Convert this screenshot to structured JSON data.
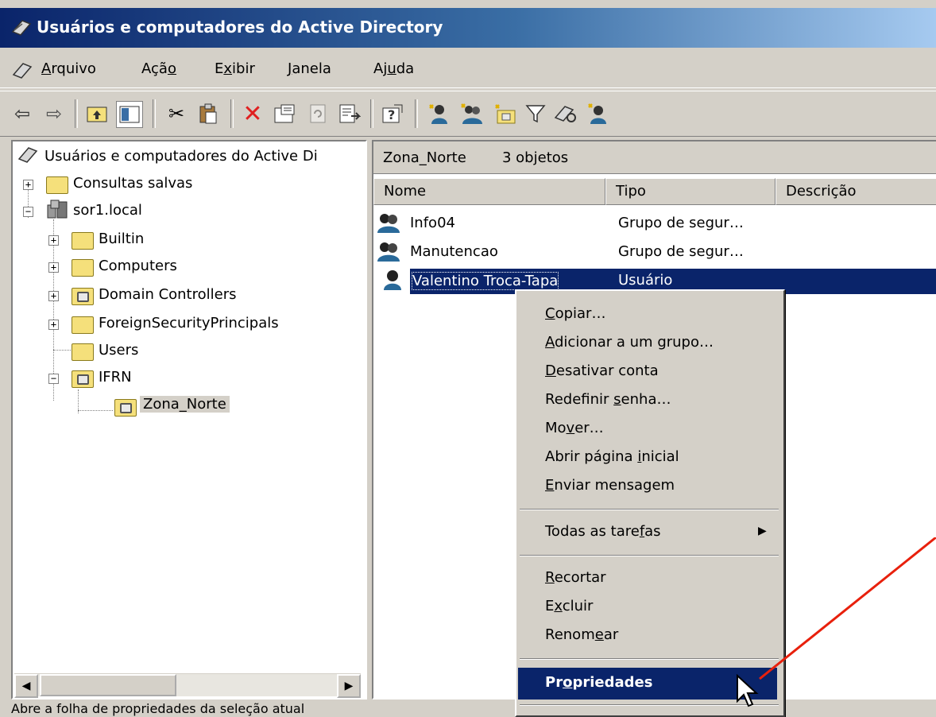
{
  "window": {
    "title": "Usuários e computadores do Active Directory"
  },
  "menu": [
    {
      "label": "Arquivo",
      "u": "A",
      "rest": "rquivo"
    },
    {
      "label": "Ação",
      "pre": "Açã",
      "u": "o",
      "rest": ""
    },
    {
      "label": "Exibir",
      "pre": "E",
      "u": "x",
      "rest": "ibir"
    },
    {
      "label": "Janela",
      "pre": "",
      "u": "J",
      "rest": "anela"
    },
    {
      "label": "Ajuda",
      "pre": "Aj",
      "u": "u",
      "rest": "da"
    }
  ],
  "tree": {
    "root": "Usuários e computadores do Active Di",
    "items": [
      {
        "label": "Consultas salvas",
        "icon": "folder-icon"
      },
      {
        "label": "sor1.local",
        "icon": "domain-icon"
      },
      {
        "label": "Builtin",
        "icon": "folder-icon"
      },
      {
        "label": "Computers",
        "icon": "folder-icon"
      },
      {
        "label": "Domain Controllers",
        "icon": "ou-icon"
      },
      {
        "label": "ForeignSecurityPrincipals",
        "icon": "folder-icon"
      },
      {
        "label": "Users",
        "icon": "folder-icon"
      },
      {
        "label": "IFRN",
        "icon": "ou-icon"
      },
      {
        "label": "Zona_Norte",
        "icon": "ou-icon"
      }
    ]
  },
  "detail": {
    "location": "Zona_Norte",
    "count": "3 objetos",
    "columns": [
      "Nome",
      "Tipo",
      "Descrição"
    ],
    "rows": [
      {
        "name": "Info04",
        "type": "Grupo de segur…",
        "icon": "group-icon"
      },
      {
        "name": "Manutencao",
        "type": "Grupo de segur…",
        "icon": "group-icon"
      },
      {
        "name": "Valentino Troca-Tapa",
        "type": "Usuário",
        "icon": "user-icon"
      }
    ]
  },
  "context_menu": {
    "items": [
      {
        "pre": "",
        "u": "C",
        "rest": "opiar…"
      },
      {
        "pre": "",
        "u": "A",
        "rest": "dicionar a um grupo…"
      },
      {
        "pre": "",
        "u": "D",
        "rest": "esativar conta"
      },
      {
        "pre": "Redefinir ",
        "u": "s",
        "rest": "enha…"
      },
      {
        "pre": "Mo",
        "u": "v",
        "rest": "er…"
      },
      {
        "pre": "Abrir página ",
        "u": "i",
        "rest": "nicial"
      },
      {
        "pre": "",
        "u": "E",
        "rest": "nviar mensagem"
      },
      {
        "pre": "Todas as tare",
        "u": "f",
        "rest": "as"
      },
      {
        "pre": "",
        "u": "R",
        "rest": "ecortar"
      },
      {
        "pre": "E",
        "u": "x",
        "rest": "cluir"
      },
      {
        "pre": "Renom",
        "u": "e",
        "rest": "ar"
      },
      {
        "pre": "Pr",
        "u": "o",
        "rest": "priedades"
      }
    ]
  },
  "status": {
    "text": "Abre a folha de propriedades da seleção atual"
  },
  "colors": {
    "titlebar": "#0a246a",
    "highlight": "#0a246a",
    "arrow": "#e8200c"
  }
}
